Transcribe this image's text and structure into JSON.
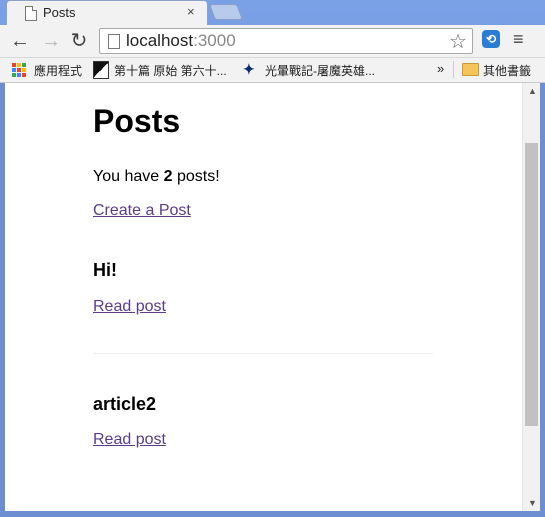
{
  "browser": {
    "tab_title": "Posts",
    "tab_close": "×",
    "url_host": "localhost",
    "url_port": ":3000",
    "icons": {
      "back": "arrow-left",
      "forward": "arrow-right",
      "reload": "reload",
      "star": "star",
      "menu": "hamburger"
    },
    "bookmarks": {
      "apps_label": "應用程式",
      "item1": "第十篇 原始 第六十...",
      "item2": "光暈戰記-屠魔英雄...",
      "more": "»",
      "other": "其他書籤"
    }
  },
  "page": {
    "title": "Posts",
    "count_prefix": "You have ",
    "count": "2",
    "count_suffix": " posts!",
    "create_link": "Create a Post",
    "posts": [
      {
        "title": "Hi!",
        "link": "Read post"
      },
      {
        "title": "article2",
        "link": "Read post"
      }
    ]
  },
  "colors": {
    "link": "#5b3c88",
    "frame": "#6d8fd1"
  }
}
